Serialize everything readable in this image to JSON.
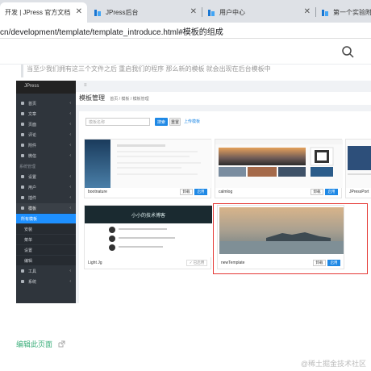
{
  "browser": {
    "tabs": [
      {
        "label": "开发 | JPress 官方文档",
        "active": true
      },
      {
        "label": "JPress后台",
        "active": false
      },
      {
        "label": "用户中心",
        "active": false
      },
      {
        "label": "第一个实验附",
        "active": false
      }
    ],
    "url_path": "cn/development/template/template_introduce.html",
    "url_hash": "#模板的组成"
  },
  "doc": {
    "quote": "当至少我们拥有这三个文件之后 重启我们的程序 那么新的模板 就会出现在后台模板中",
    "edit_link": "编辑此页面",
    "watermark": "@稀土掘金技术社区"
  },
  "admin": {
    "brand": "JPress",
    "page_title": "模板管理",
    "breadcrumb": "首页 / 模板 / 模板管理",
    "filter_placeholder": "模板名称",
    "search_btn": "搜索",
    "reset_btn": "重置",
    "upload_link": "上传模板",
    "sidebar": [
      {
        "label": "首页",
        "kind": "item"
      },
      {
        "label": "文章",
        "kind": "item"
      },
      {
        "label": "页面",
        "kind": "item"
      },
      {
        "label": "评论",
        "kind": "item"
      },
      {
        "label": "附件",
        "kind": "item"
      },
      {
        "label": "微信",
        "kind": "item"
      },
      {
        "label": "系统管理",
        "kind": "header"
      },
      {
        "label": "设置",
        "kind": "item"
      },
      {
        "label": "用户",
        "kind": "item"
      },
      {
        "label": "插件",
        "kind": "item"
      },
      {
        "label": "模板",
        "kind": "group"
      },
      {
        "label": "所有模板",
        "kind": "active"
      },
      {
        "label": "安装",
        "kind": "sub"
      },
      {
        "label": "菜单",
        "kind": "sub"
      },
      {
        "label": "设置",
        "kind": "sub"
      },
      {
        "label": "编辑",
        "kind": "sub"
      },
      {
        "label": "工具",
        "kind": "item"
      },
      {
        "label": "系统",
        "kind": "item"
      }
    ],
    "templates": [
      {
        "name": "bootnature",
        "btn1": "卸载",
        "btn2": "启用"
      },
      {
        "name": "calmlog",
        "btn1": "卸载",
        "btn2": "启用"
      },
      {
        "name": "JPressPort",
        "btn1": "",
        "btn2": ""
      },
      {
        "name": "Light Jg",
        "btn1": "✓ 已启用",
        "btn2": ""
      },
      {
        "name": "newTemplate",
        "btn1": "卸载",
        "btn2": "启用"
      }
    ],
    "light_header": "小小的技术博客"
  },
  "colors": {
    "accent": "#1e88e5",
    "highlight": "#e53935",
    "link": "#3eaf7c"
  }
}
